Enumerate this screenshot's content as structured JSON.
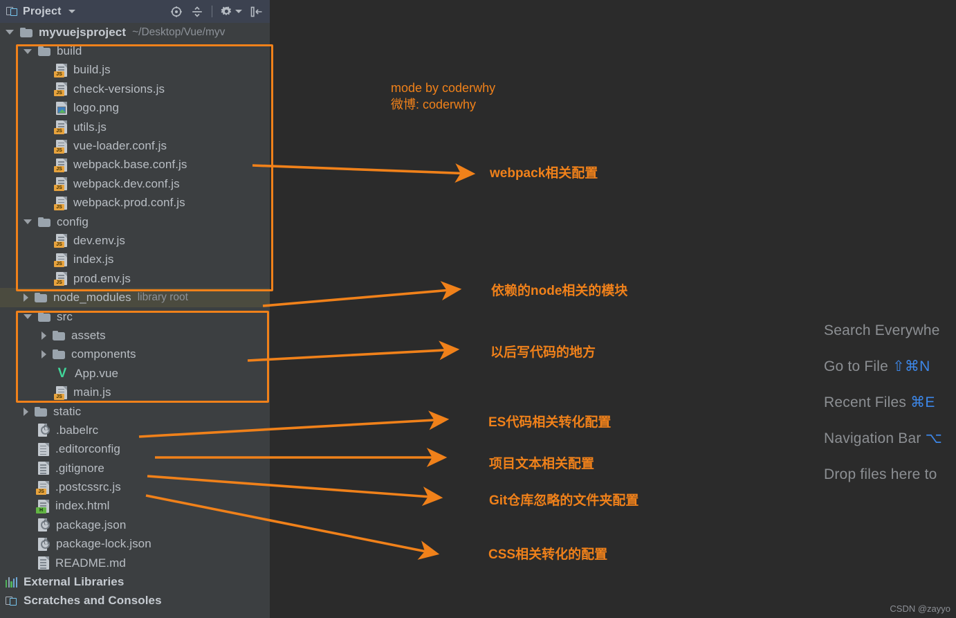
{
  "toolbar": {
    "title": "Project",
    "project_icon": "project-window-icon",
    "dropdown_icon": "chevron-down-icon",
    "icons": [
      {
        "name": "locate-icon",
        "label": "Select Opened File"
      },
      {
        "name": "collapse-all-icon",
        "label": "Collapse All"
      },
      {
        "name": "settings-gear-icon",
        "label": "Settings"
      },
      {
        "name": "hide-panel-icon",
        "label": "Hide"
      }
    ]
  },
  "tree": {
    "root": {
      "name": "myvuejsproject",
      "path": "~/Desktop/Vue/myv"
    },
    "items": [
      {
        "label": "build",
        "indent": 1,
        "type": "folder",
        "state": "open",
        "icon": "folder-icon"
      },
      {
        "label": "build.js",
        "indent": 2,
        "type": "file",
        "icon": "js-file-icon",
        "badge": "JS"
      },
      {
        "label": "check-versions.js",
        "indent": 2,
        "type": "file",
        "icon": "js-file-icon",
        "badge": "JS"
      },
      {
        "label": "logo.png",
        "indent": 2,
        "type": "file",
        "icon": "png-file-icon"
      },
      {
        "label": "utils.js",
        "indent": 2,
        "type": "file",
        "icon": "js-file-icon",
        "badge": "JS"
      },
      {
        "label": "vue-loader.conf.js",
        "indent": 2,
        "type": "file",
        "icon": "js-file-icon",
        "badge": "JS"
      },
      {
        "label": "webpack.base.conf.js",
        "indent": 2,
        "type": "file",
        "icon": "js-file-icon",
        "badge": "JS"
      },
      {
        "label": "webpack.dev.conf.js",
        "indent": 2,
        "type": "file",
        "icon": "js-file-icon",
        "badge": "JS"
      },
      {
        "label": "webpack.prod.conf.js",
        "indent": 2,
        "type": "file",
        "icon": "js-file-icon",
        "badge": "JS"
      },
      {
        "label": "config",
        "indent": 1,
        "type": "folder",
        "state": "open",
        "icon": "folder-icon"
      },
      {
        "label": "dev.env.js",
        "indent": 2,
        "type": "file",
        "icon": "js-file-icon",
        "badge": "JS"
      },
      {
        "label": "index.js",
        "indent": 2,
        "type": "file",
        "icon": "js-file-icon",
        "badge": "JS"
      },
      {
        "label": "prod.env.js",
        "indent": 2,
        "type": "file",
        "icon": "js-file-icon",
        "badge": "JS"
      },
      {
        "label": "node_modules",
        "indent": 1,
        "type": "folder",
        "state": "closed",
        "icon": "folder-icon",
        "sub": "library root",
        "highlighted": true
      },
      {
        "label": "src",
        "indent": 1,
        "type": "folder",
        "state": "open",
        "icon": "folder-icon"
      },
      {
        "label": "assets",
        "indent": 2,
        "type": "folder",
        "state": "closed",
        "icon": "folder-icon"
      },
      {
        "label": "components",
        "indent": 2,
        "type": "folder",
        "state": "closed",
        "icon": "folder-icon"
      },
      {
        "label": "App.vue",
        "indent": 2,
        "type": "file",
        "icon": "vue-file-icon"
      },
      {
        "label": "main.js",
        "indent": 2,
        "type": "file",
        "icon": "js-file-icon",
        "badge": "JS"
      },
      {
        "label": "static",
        "indent": 1,
        "type": "folder",
        "state": "closed",
        "icon": "folder-icon"
      },
      {
        "label": ".babelrc",
        "indent": 1,
        "type": "file",
        "icon": "json-file-icon"
      },
      {
        "label": ".editorconfig",
        "indent": 1,
        "type": "file",
        "icon": "text-file-icon"
      },
      {
        "label": ".gitignore",
        "indent": 1,
        "type": "file",
        "icon": "text-file-icon"
      },
      {
        "label": ".postcssrc.js",
        "indent": 1,
        "type": "file",
        "icon": "js-file-icon",
        "badge": "JS"
      },
      {
        "label": "index.html",
        "indent": 1,
        "type": "file",
        "icon": "html-file-icon",
        "badge": "H"
      },
      {
        "label": "package.json",
        "indent": 1,
        "type": "file",
        "icon": "json-file-icon"
      },
      {
        "label": "package-lock.json",
        "indent": 1,
        "type": "file",
        "icon": "json-file-icon"
      },
      {
        "label": "README.md",
        "indent": 1,
        "type": "file",
        "icon": "text-file-icon"
      },
      {
        "label": "External Libraries",
        "indent": 0,
        "type": "node",
        "icon": "libraries-bars-icon"
      },
      {
        "label": "Scratches and Consoles",
        "indent": 0,
        "type": "node",
        "icon": "scratches-icon"
      }
    ]
  },
  "annotations": {
    "credit_line1": "mode by coderwhy",
    "credit_line2": "微博: coderwhy",
    "labels": [
      {
        "text": "webpack相关配置"
      },
      {
        "text": "依赖的node相关的模块"
      },
      {
        "text": "以后写代码的地方"
      },
      {
        "text": "ES代码相关转化配置"
      },
      {
        "text": "项目文本相关配置"
      },
      {
        "text": "Git仓库忽略的文件夹配置"
      },
      {
        "text": "CSS相关转化的配置"
      }
    ],
    "accent_color": "#f0811a"
  },
  "editor_hints": [
    {
      "label": "Search Everywhe",
      "key": ""
    },
    {
      "label": "Go to File",
      "key": "⇧⌘N"
    },
    {
      "label": "Recent Files",
      "key": "⌘E"
    },
    {
      "label": "Navigation Bar",
      "key": "⌥"
    },
    {
      "label": "Drop files here to",
      "key": ""
    }
  ],
  "watermark": "CSDN @zayyo"
}
